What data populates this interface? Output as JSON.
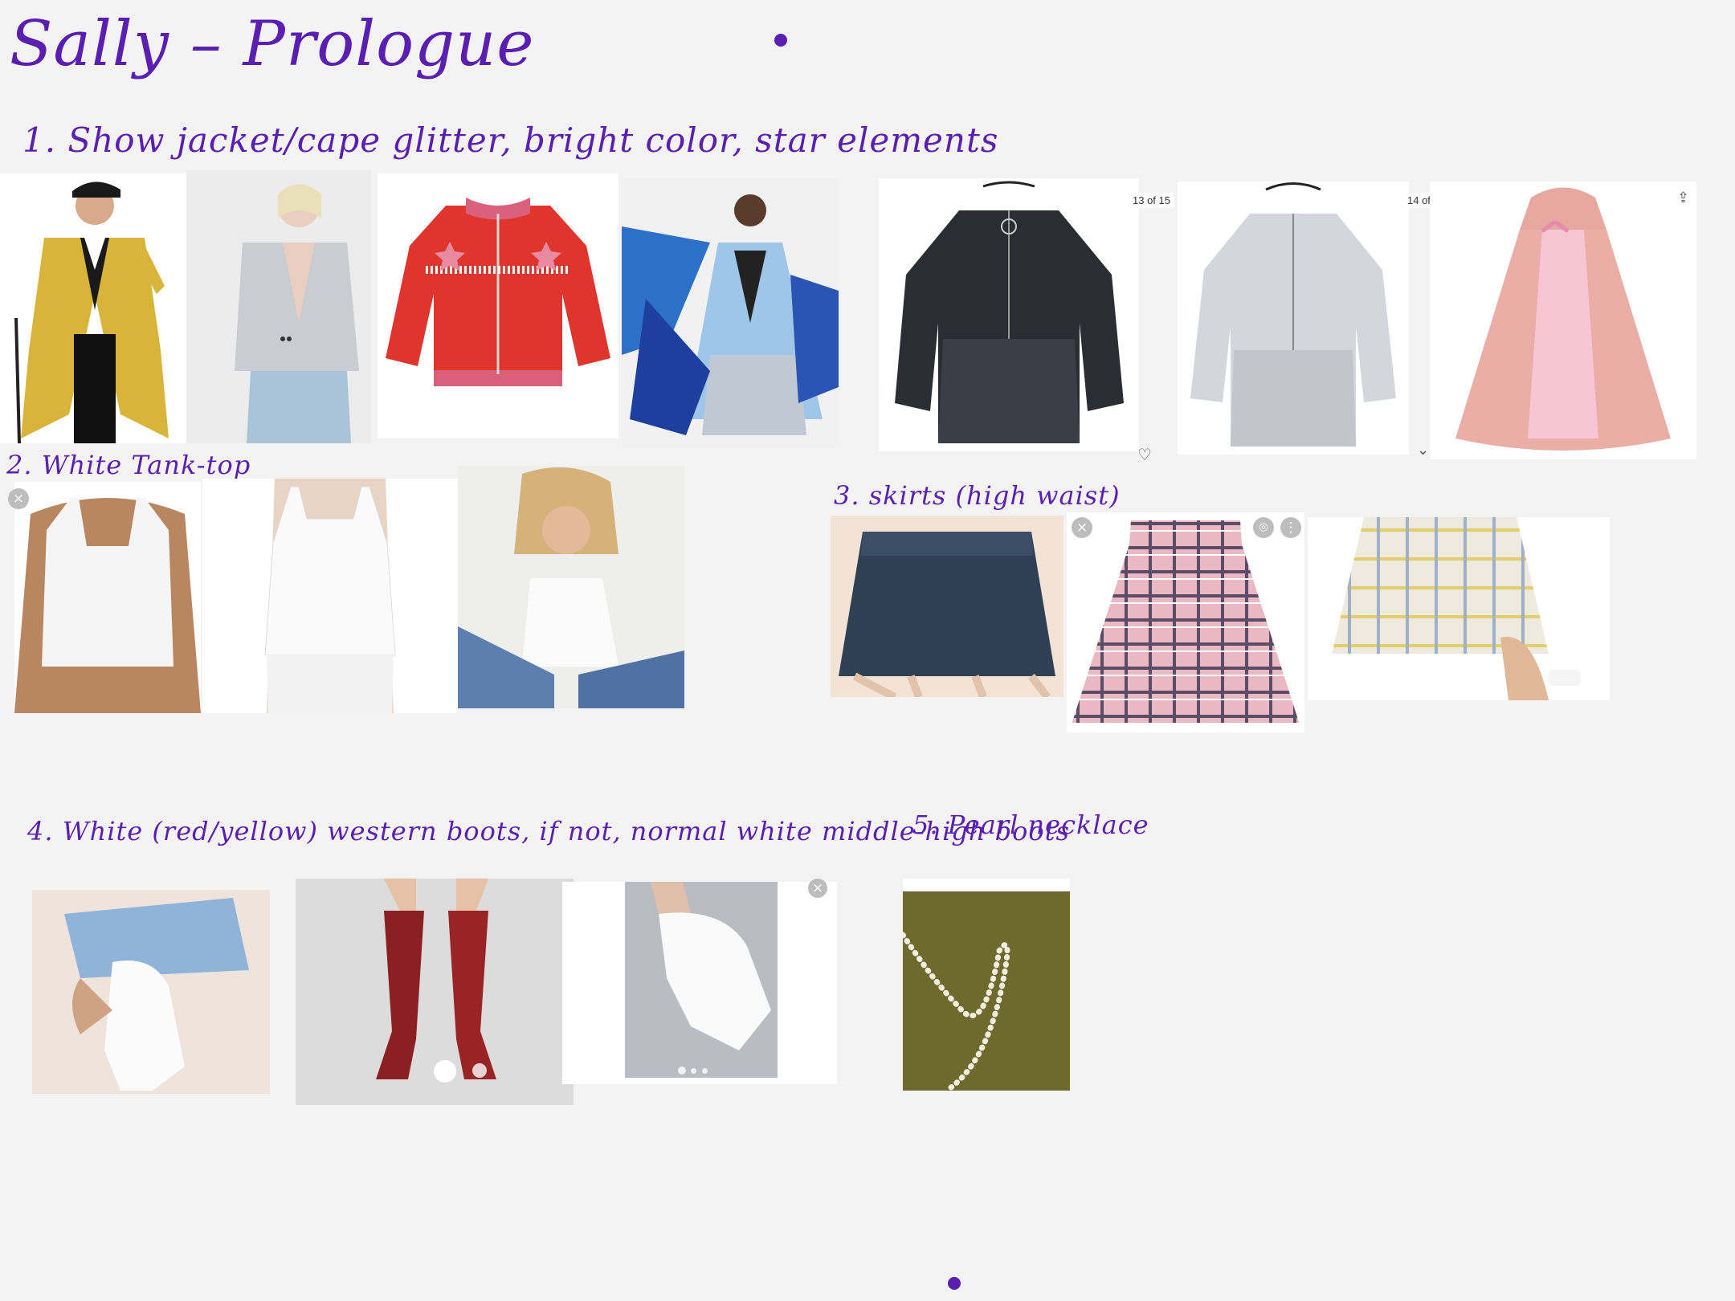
{
  "page": {
    "title": "Sally – Prologue",
    "accent_color": "#5a1fb0"
  },
  "sections": {
    "jackets": {
      "heading": "1. Show jacket/cape   glitter, bright color, star elements"
    },
    "tanks": {
      "heading": "2. White Tank-top"
    },
    "skirts": {
      "heading": "3. skirts (high waist)"
    },
    "boots": {
      "heading": "4. White (red/yellow) western boots, if not, normal white middle-high boots"
    },
    "pearls": {
      "heading": "5. Pearl necklace"
    }
  },
  "overlays": {
    "counter_a": "13 of 15",
    "counter_b": "14 of",
    "close_icon": "close-icon",
    "heart_icon": "heart-outline-icon",
    "share_icon": "share-icon",
    "more_icon": "more-vert-icon",
    "ellipsis": "···"
  }
}
